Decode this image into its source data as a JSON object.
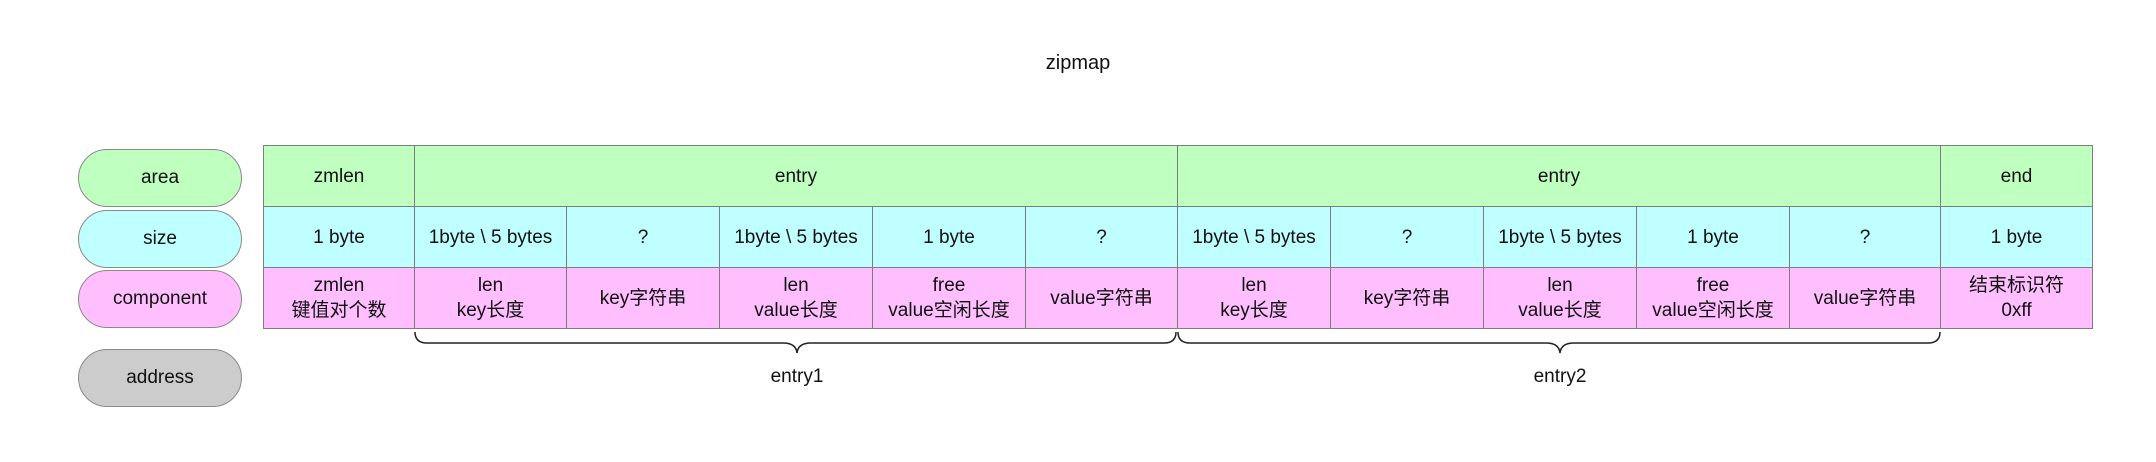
{
  "title": "zipmap",
  "row_labels": {
    "area": "area",
    "size": "size",
    "component": "component",
    "address": "address"
  },
  "area_row": [
    "zmlen",
    "entry",
    "entry",
    "end"
  ],
  "size_row": [
    "1 byte",
    "1byte \\ 5 bytes",
    "?",
    "1byte \\ 5 bytes",
    "1 byte",
    "?",
    "1byte \\ 5 bytes",
    "?",
    "1byte \\ 5 bytes",
    "1 byte",
    "?",
    "1 byte"
  ],
  "component_row": [
    [
      "zmlen",
      "键值对个数"
    ],
    [
      "len",
      "key长度"
    ],
    [
      "key字符串"
    ],
    [
      "len",
      "value长度"
    ],
    [
      "free",
      "value空闲长度"
    ],
    [
      "value字符串"
    ],
    [
      "len",
      "key长度"
    ],
    [
      "key字符串"
    ],
    [
      "len",
      "value长度"
    ],
    [
      "free",
      "value空闲长度"
    ],
    [
      "value字符串"
    ],
    [
      "结束标识符",
      "0xff"
    ]
  ],
  "braces": [
    "entry1",
    "entry2"
  ],
  "colors": {
    "area": "#bfffc0",
    "size": "#bfffff",
    "component": "#ffbfff",
    "address": "#cccccc"
  }
}
